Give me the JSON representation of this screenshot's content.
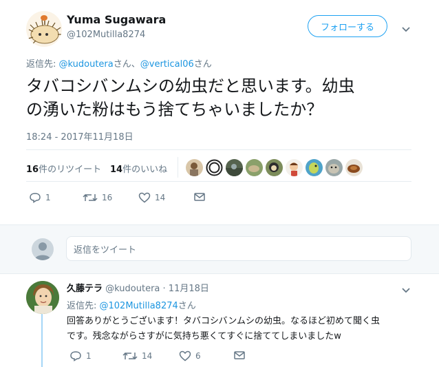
{
  "tweet": {
    "display_name": "Yuma Sugawara",
    "handle": "@102Mutilla8274",
    "follow_label": "フォローする",
    "reply_to_prefix": "返信先: ",
    "reply_to_user1": "@kudoutera",
    "reply_to_sep": "さん、",
    "reply_to_user2": "@vertical06",
    "reply_to_suffix": "さん",
    "text_line1": "タバコシバンムシの幼虫だと思います。幼虫",
    "text_line2": "の湧いた粉はもう捨てちゃいましたか？",
    "timestamp": "18:24 - 2017年11月18日",
    "retweet_count": "16",
    "retweet_label": "件のリツイート",
    "like_count": "14",
    "like_label": "件のいいね",
    "actions": {
      "reply_count": "1",
      "retweet_count": "16",
      "like_count": "14"
    }
  },
  "reply_box": {
    "placeholder": "返信をツイート"
  },
  "reply": {
    "display_name": "久藤テラ",
    "handle": "@kudoutera",
    "dot": "·",
    "date": "11月18日",
    "reply_to_prefix": "返信先: ",
    "reply_to_user": "@102Mutilla8274",
    "reply_to_suffix": "さん",
    "text_line1": "回答ありがとうございます！タバコシバンムシの幼虫。なるほど初めて聞く虫",
    "text_line2": "です。残念ながらさすがに気持ち悪くてすぐに捨ててしまいましたw",
    "actions": {
      "reply_count": "1",
      "retweet_count": "14",
      "like_count": "6"
    }
  },
  "colors": {
    "accent": "#1da1f2",
    "link": "#1b95e0",
    "muted": "#657786",
    "divider": "#e6ecf0"
  }
}
